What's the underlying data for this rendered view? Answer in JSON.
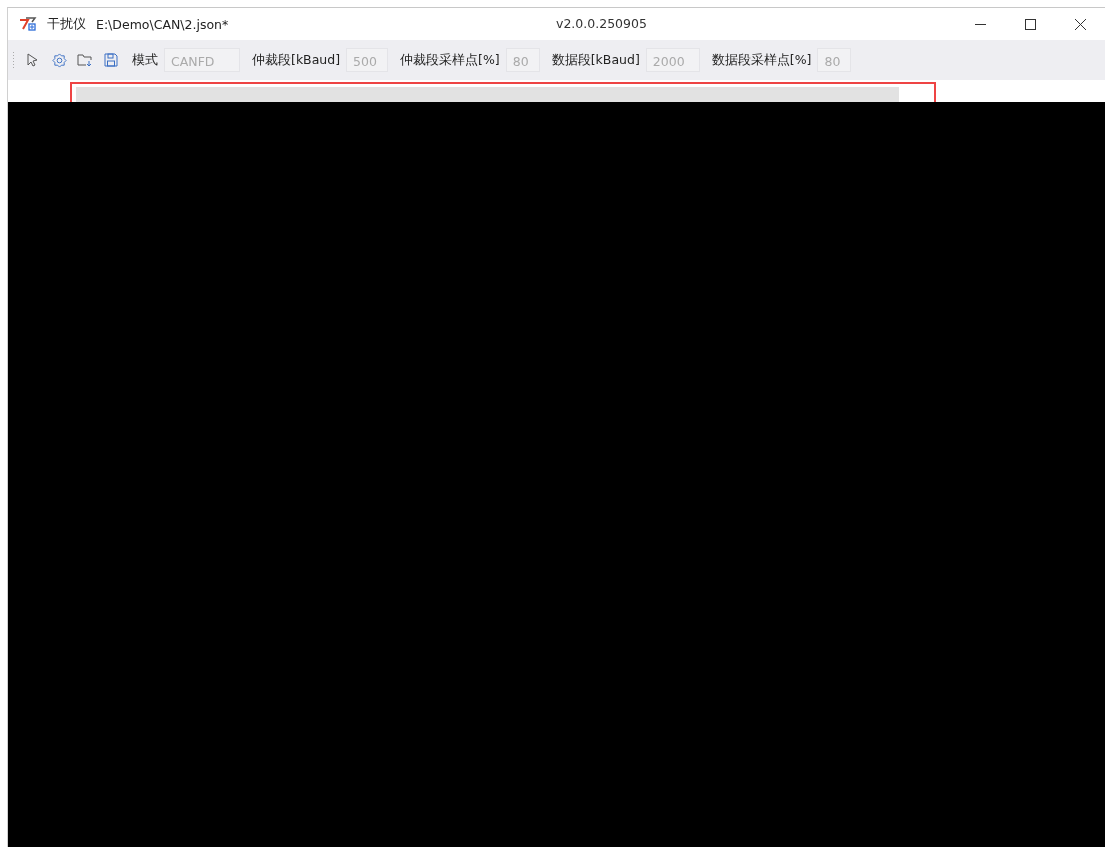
{
  "window": {
    "app_name": "干扰仪",
    "file_path": "E:\\Demo\\CAN\\2.json*",
    "version": "v2.0.0.250905"
  },
  "toolbar": {
    "fields": [
      {
        "label": "模式",
        "value": "CANFD",
        "disabled": true
      },
      {
        "label": "仲裁段[kBaud]",
        "value": "500",
        "disabled": true
      },
      {
        "label": "仲裁段采样点[%]",
        "value": "80",
        "disabled": true
      },
      {
        "label": "数据段[kBaud]",
        "value": "2000",
        "disabled": true
      },
      {
        "label": "数据段采样点[%]",
        "value": "80",
        "disabled": true
      }
    ]
  }
}
